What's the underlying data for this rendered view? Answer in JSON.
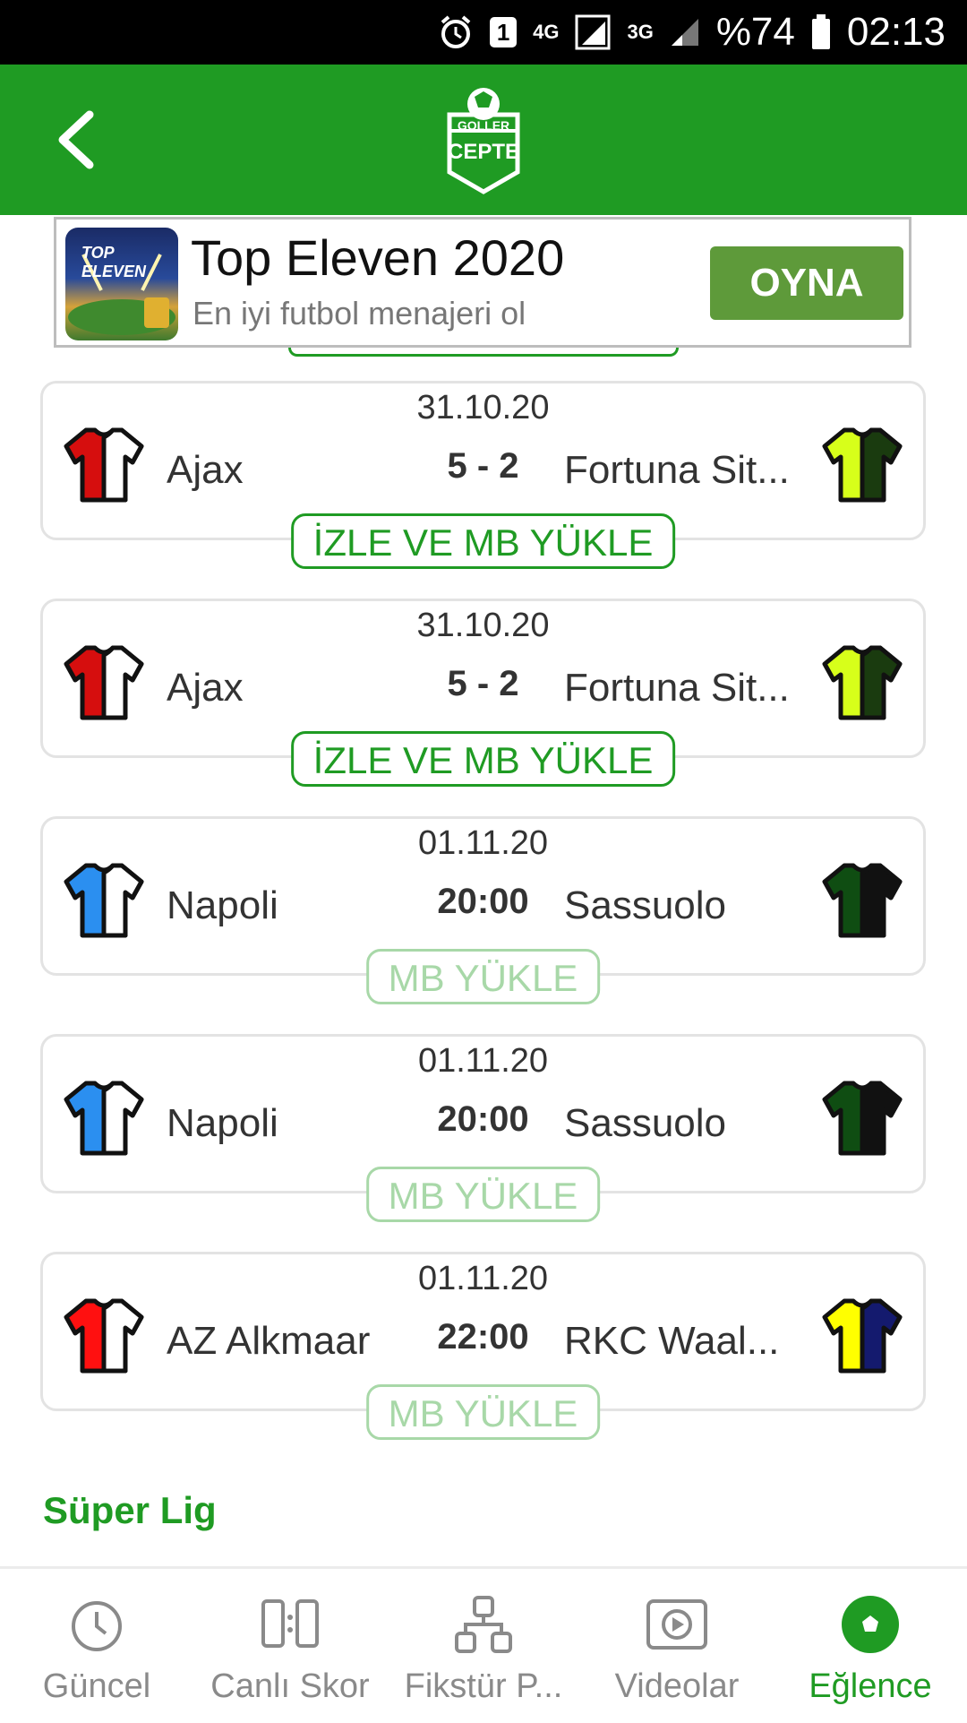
{
  "status_bar": {
    "network1": "4G",
    "network2": "3G",
    "sim_badge": "1",
    "battery": "%74",
    "time": "02:13"
  },
  "app_bar": {
    "logo_line1": "GOLLER",
    "logo_line2": "CEPTE"
  },
  "ad": {
    "thumb_text": "TOP ELEVEN",
    "title": "Top Eleven 2020",
    "subtitle": "En iyi futbol menajeri ol",
    "cta": "OYNA"
  },
  "matches": [
    {
      "date": "31.10.20",
      "home": "Ajax",
      "score": "5 - 2",
      "away": "Fortuna Sit...",
      "action": "İZLE VE MB YÜKLE",
      "action_style": "strong",
      "home_colors": [
        "#d60e0e",
        "#ffffff"
      ],
      "away_colors": [
        "#d7ff1a",
        "#1a3b0f"
      ]
    },
    {
      "date": "31.10.20",
      "home": "Ajax",
      "score": "5 - 2",
      "away": "Fortuna Sit...",
      "action": "İZLE VE MB YÜKLE",
      "action_style": "strong",
      "home_colors": [
        "#d60e0e",
        "#ffffff"
      ],
      "away_colors": [
        "#d7ff1a",
        "#1a3b0f"
      ]
    },
    {
      "date": "01.11.20",
      "home": "Napoli",
      "score": "20:00",
      "away": "Sassuolo",
      "action": "MB YÜKLE",
      "action_style": "light",
      "home_colors": [
        "#2b8ff0",
        "#ffffff"
      ],
      "away_colors": [
        "#0f4d12",
        "#111111"
      ]
    },
    {
      "date": "01.11.20",
      "home": "Napoli",
      "score": "20:00",
      "away": "Sassuolo",
      "action": "MB YÜKLE",
      "action_style": "light",
      "home_colors": [
        "#2b8ff0",
        "#ffffff"
      ],
      "away_colors": [
        "#0f4d12",
        "#111111"
      ]
    },
    {
      "date": "01.11.20",
      "home": "AZ Alkmaar",
      "score": "22:00",
      "away": "RKC Waal...",
      "action": "MB YÜKLE",
      "action_style": "light",
      "home_colors": [
        "#ff1010",
        "#ffffff"
      ],
      "away_colors": [
        "#ffff00",
        "#141a6e"
      ]
    }
  ],
  "section_title": "Süper Lig",
  "bottom_nav": [
    {
      "label": "Güncel",
      "icon": "clock-icon",
      "active": false
    },
    {
      "label": "Canlı Skor",
      "icon": "scoreboard-icon",
      "active": false
    },
    {
      "label": "Fikstür P...",
      "icon": "fixture-icon",
      "active": false
    },
    {
      "label": "Videolar",
      "icon": "video-icon",
      "active": false
    },
    {
      "label": "Eğlence",
      "icon": "football-icon",
      "active": true
    }
  ],
  "colors": {
    "brand_green": "#1f9b23",
    "light_green": "#a8d8a8",
    "ad_button": "#5e9a3a"
  }
}
